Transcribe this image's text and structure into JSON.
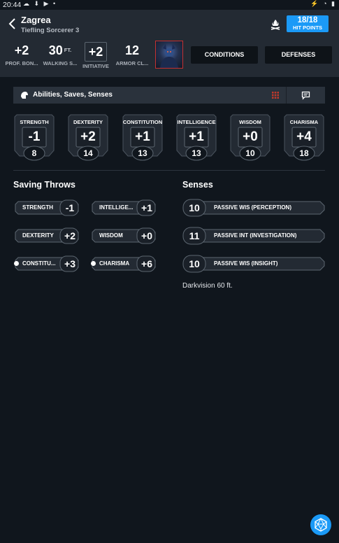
{
  "status_bar": {
    "time": "20:44"
  },
  "header": {
    "name": "Zagrea",
    "subtitle": "Tiefling Sorcerer 3",
    "hit_points": {
      "value": "18/18",
      "label": "HIT POINTS"
    },
    "stats": [
      {
        "value": "+2",
        "unit": "",
        "label": "PROF. BON..."
      },
      {
        "value": "30",
        "unit": "FT.",
        "label": "WALKING S..."
      },
      {
        "value": "+2",
        "unit": "",
        "label": "INITIATIVE"
      },
      {
        "value": "12",
        "unit": "",
        "label": "ARMOR CL..."
      }
    ],
    "buttons": {
      "conditions": "CONDITIONS",
      "defenses": "DEFENSES"
    }
  },
  "section": {
    "title": "Abilities, Saves, Senses"
  },
  "abilities": [
    {
      "name": "STRENGTH",
      "modifier": "-1",
      "score": "8"
    },
    {
      "name": "DEXTERITY",
      "modifier": "+2",
      "score": "14"
    },
    {
      "name": "CONSTITUTION",
      "modifier": "+1",
      "score": "13"
    },
    {
      "name": "INTELLIGENCE",
      "modifier": "+1",
      "score": "13"
    },
    {
      "name": "WISDOM",
      "modifier": "+0",
      "score": "10"
    },
    {
      "name": "CHARISMA",
      "modifier": "+4",
      "score": "18"
    }
  ],
  "saving_throws": {
    "title": "Saving Throws",
    "items": [
      {
        "label": "STRENGTH",
        "value": "-1",
        "proficient": false
      },
      {
        "label": "INTELLIGE...",
        "value": "+1",
        "proficient": false
      },
      {
        "label": "DEXTERITY",
        "value": "+2",
        "proficient": false
      },
      {
        "label": "WISDOM",
        "value": "+0",
        "proficient": false
      },
      {
        "label": "CONSTITU...",
        "value": "+3",
        "proficient": true
      },
      {
        "label": "CHARISMA",
        "value": "+6",
        "proficient": true
      }
    ]
  },
  "senses": {
    "title": "Senses",
    "items": [
      {
        "value": "10",
        "label": "PASSIVE WIS (PERCEPTION)"
      },
      {
        "value": "11",
        "label": "PASSIVE INT (INVESTIGATION)"
      },
      {
        "value": "10",
        "label": "PASSIVE WIS (INSIGHT)"
      }
    ],
    "note": "Darkvision 60 ft."
  },
  "colors": {
    "accent": "#1b9af7",
    "header_bg": "#232a33",
    "page_bg": "#10161d",
    "avatar_border": "#c53131",
    "grid_icon": "#c0392b"
  }
}
